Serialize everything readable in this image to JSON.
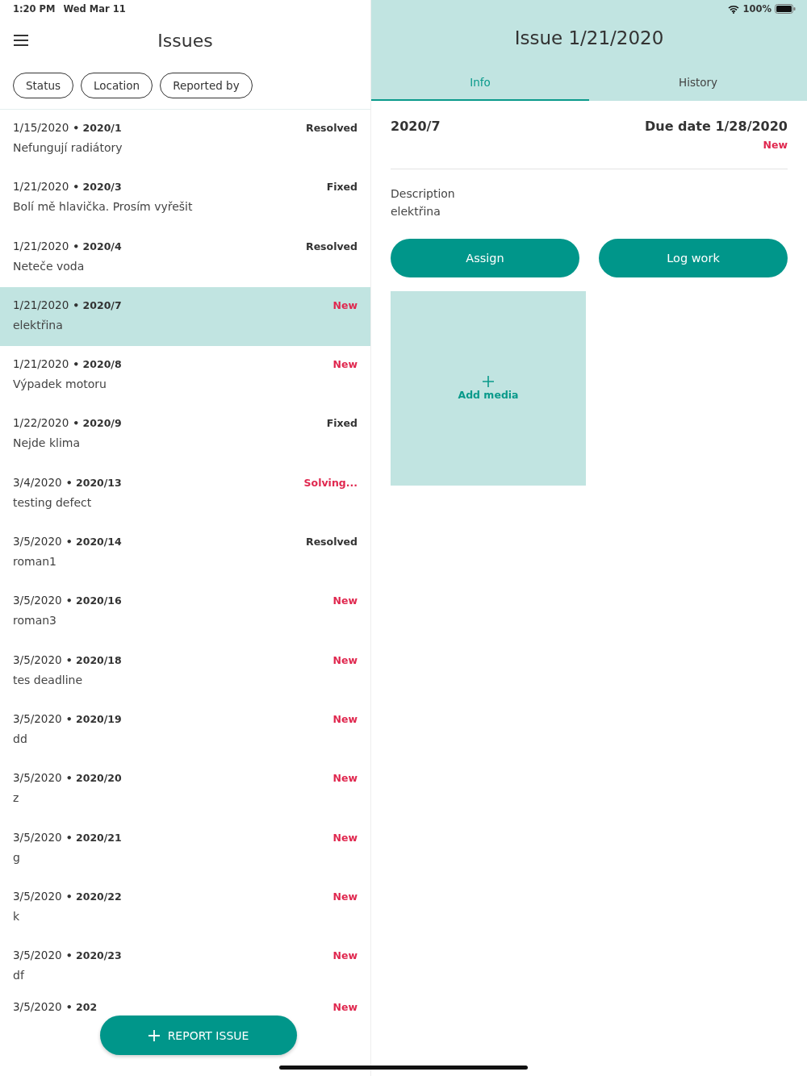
{
  "status_bar": {
    "time": "1:20 PM",
    "date": "Wed Mar 11",
    "battery": "100%"
  },
  "list_header": {
    "title": "Issues"
  },
  "filters": [
    "Status",
    "Location",
    "Reported by"
  ],
  "issues": [
    {
      "date": "1/15/2020",
      "number": "• 2020/1",
      "title": "Nefungují radiátory",
      "status": "Resolved",
      "color": "#333333",
      "selected": false
    },
    {
      "date": "1/21/2020",
      "number": "• 2020/3",
      "title": "Bolí mě hlavička. Prosím vyřešit",
      "status": "Fixed",
      "color": "#333333",
      "selected": false
    },
    {
      "date": "1/21/2020",
      "number": "• 2020/4",
      "title": "Neteče voda",
      "status": "Resolved",
      "color": "#333333",
      "selected": false
    },
    {
      "date": "1/21/2020",
      "number": "• 2020/7",
      "title": "elektřina",
      "status": "New",
      "color": "#e0284f",
      "selected": true
    },
    {
      "date": "1/21/2020",
      "number": "• 2020/8",
      "title": "Výpadek motoru",
      "status": "New",
      "color": "#e0284f",
      "selected": false
    },
    {
      "date": "1/22/2020",
      "number": "• 2020/9",
      "title": "Nejde klima",
      "status": "Fixed",
      "color": "#333333",
      "selected": false
    },
    {
      "date": "3/4/2020",
      "number": "• 2020/13",
      "title": "testing defect",
      "status": "Solving...",
      "color": "#e0284f",
      "selected": false
    },
    {
      "date": "3/5/2020",
      "number": "• 2020/14",
      "title": "roman1",
      "status": "Resolved",
      "color": "#333333",
      "selected": false
    },
    {
      "date": "3/5/2020",
      "number": "• 2020/16",
      "title": "roman3",
      "status": "New",
      "color": "#e0284f",
      "selected": false
    },
    {
      "date": "3/5/2020",
      "number": "• 2020/18",
      "title": "tes deadline",
      "status": "New",
      "color": "#e0284f",
      "selected": false
    },
    {
      "date": "3/5/2020",
      "number": "• 2020/19",
      "title": "dd",
      "status": "New",
      "color": "#e0284f",
      "selected": false
    },
    {
      "date": "3/5/2020",
      "number": "• 2020/20",
      "title": "z",
      "status": "New",
      "color": "#e0284f",
      "selected": false
    },
    {
      "date": "3/5/2020",
      "number": "• 2020/21",
      "title": "g",
      "status": "New",
      "color": "#e0284f",
      "selected": false
    },
    {
      "date": "3/5/2020",
      "number": "• 2020/22",
      "title": "k",
      "status": "New",
      "color": "#e0284f",
      "selected": false
    },
    {
      "date": "3/5/2020",
      "number": "• 2020/23",
      "title": "df",
      "status": "New",
      "color": "#e0284f",
      "selected": false
    },
    {
      "date": "3/5/2020",
      "number": "• 202",
      "status": "New",
      "color": "#e0284f",
      "selected": false
    }
  ],
  "report_button": {
    "label": "REPORT ISSUE"
  },
  "detail": {
    "title": "Issue 1/21/2020",
    "tabs": [
      {
        "label": "Info",
        "selected": true
      },
      {
        "label": "History",
        "selected": false
      }
    ],
    "number": "2020/7",
    "due_date": "Due date 1/28/2020",
    "status": "New",
    "description_label": "Description",
    "description": "elektřina",
    "buttons": [
      "Assign",
      "Log work"
    ],
    "add_media": "Add media"
  }
}
